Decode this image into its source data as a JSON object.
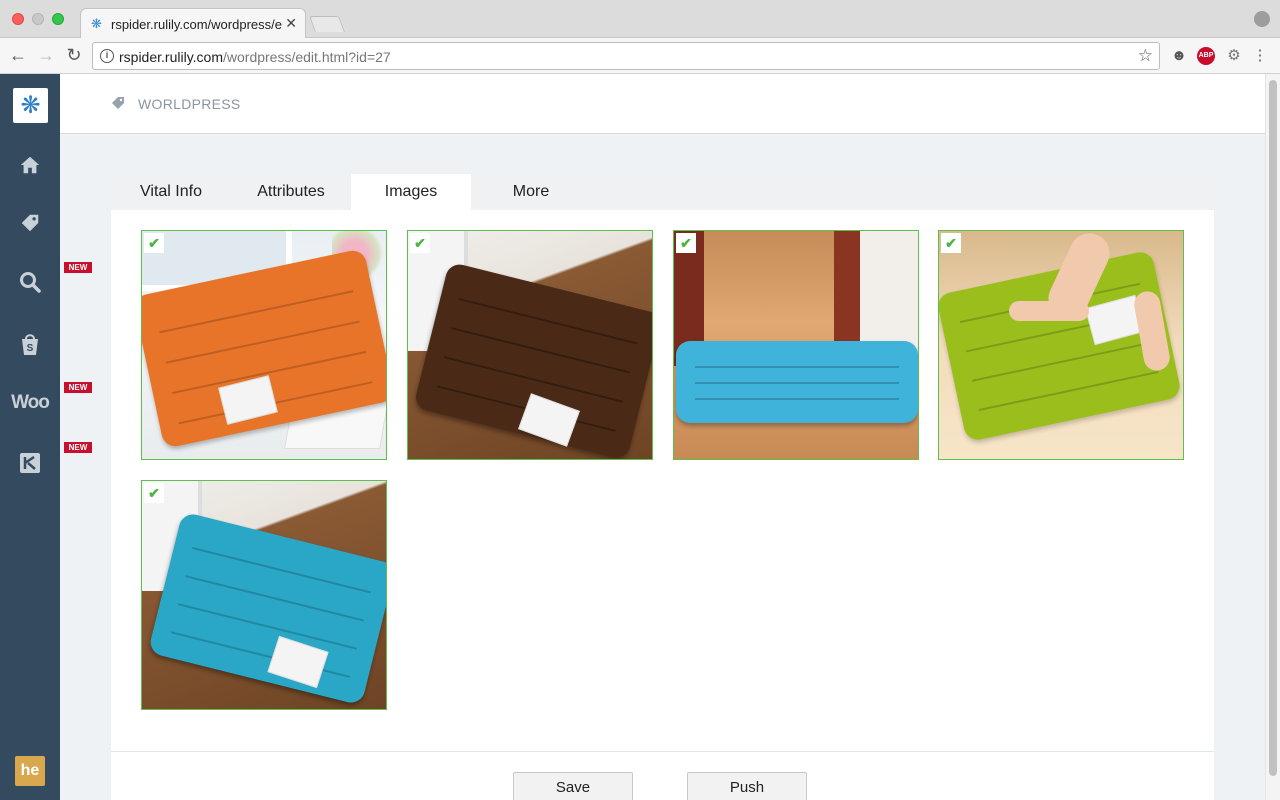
{
  "browser": {
    "tab_title": "rspider.rulily.com/wordpress/e",
    "url_host": "rspider.rulily.com",
    "url_path": "/wordpress/edit.html?id=27",
    "ext_abp": "ABP"
  },
  "sidebar": {
    "badges": [
      "NEW",
      "NEW",
      "NEW"
    ],
    "woo_label": "Woo",
    "he_label": "he"
  },
  "header": {
    "title": "WORLDPRESS"
  },
  "tabs": [
    {
      "label": "Vital Info"
    },
    {
      "label": "Attributes"
    },
    {
      "label": "Images"
    },
    {
      "label": "More"
    }
  ],
  "images": [
    {
      "color": "orange",
      "checked": true
    },
    {
      "color": "brown",
      "checked": true
    },
    {
      "color": "light-blue",
      "checked": true
    },
    {
      "color": "lime-green",
      "checked": true
    },
    {
      "color": "teal-blue",
      "checked": true
    }
  ],
  "buttons": {
    "save": "Save",
    "push": "Push"
  },
  "colors": {
    "sidebar": "#344a5e",
    "check_border": "#5cc14b"
  }
}
